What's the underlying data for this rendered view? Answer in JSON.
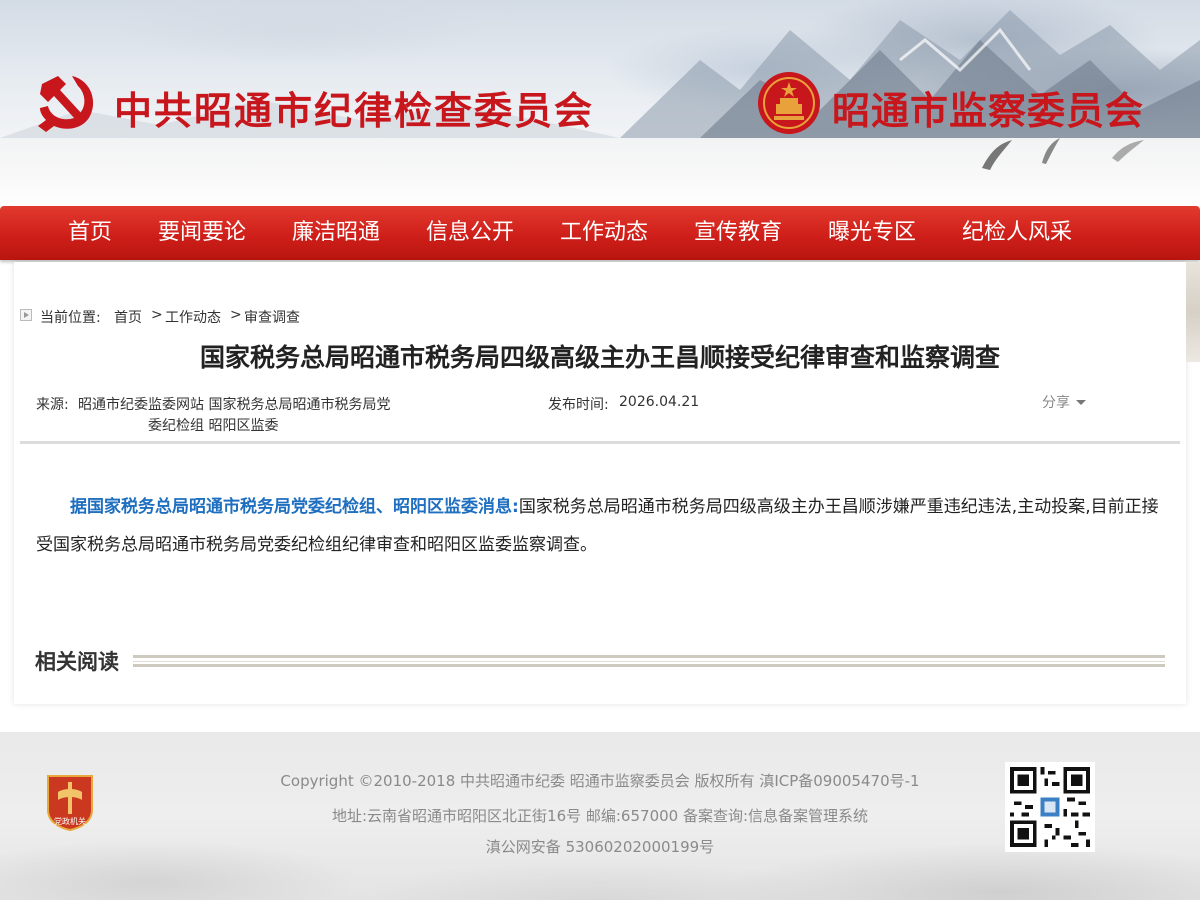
{
  "header": {
    "title_left": "中共昭通市纪律检查委员会",
    "title_right": "昭通市监察委员会",
    "brand_color": "#c8161d"
  },
  "nav": {
    "items": [
      {
        "label": "首页"
      },
      {
        "label": "要闻要论"
      },
      {
        "label": "廉洁昭通"
      },
      {
        "label": "信息公开"
      },
      {
        "label": "工作动态"
      },
      {
        "label": "宣传教育"
      },
      {
        "label": "曝光专区"
      },
      {
        "label": "纪检人风采"
      }
    ],
    "bg_color": "#cf1f1a"
  },
  "breadcrumb": {
    "label": "当前位置:",
    "items": [
      "首页",
      "工作动态",
      "审查调查"
    ],
    "separator": ">"
  },
  "article": {
    "title": "国家税务总局昭通市税务局四级高级主办王昌顺接受纪律审查和监察调查",
    "source_label": "来源:",
    "source_line1": "昭通市纪委监委网站 国家税务总局昭通市税务局党",
    "source_line2": "委纪检组 昭阳区监委",
    "date_label": "发布时间:",
    "date": "2026.04.21",
    "share_label": "分享",
    "body_lead": "据国家税务总局昭通市税务局党委纪检组、昭阳区监委消息:",
    "body_text": "国家税务总局昭通市税务局四级高级主办王昌顺涉嫌严重违纪违法,主动投案,目前正接受国家税务总局昭通市税务局党委纪检组纪律审查和昭阳区监委监察调查。",
    "lead_color": "#1f6fc0"
  },
  "related": {
    "title": "相关阅读"
  },
  "footer": {
    "copyright": "Copyright ©2010-2018 中共昭通市纪委 昭通市监察委员会 版权所有 滇ICP备09005470号-1",
    "address": "地址:云南省昭通市昭阳区北正街16号  邮编:657000 备案查询:信息备案管理系统",
    "security": "滇公网安备 53060202000199号",
    "emblem_text": "党政机关"
  }
}
